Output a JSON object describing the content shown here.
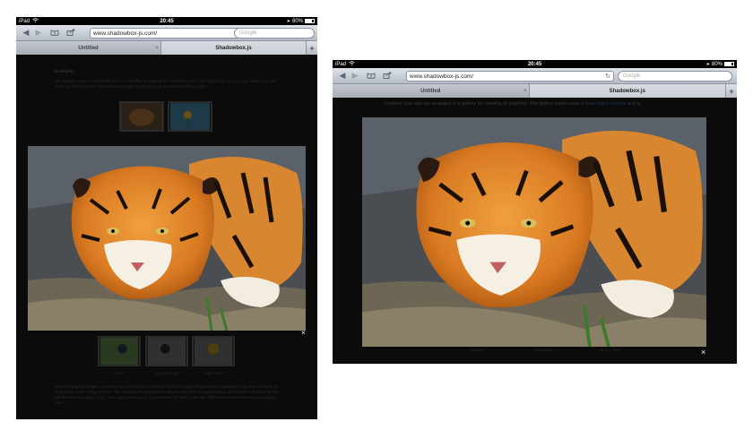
{
  "status": {
    "device": "iPad",
    "time": "20:45",
    "battery": "80%"
  },
  "browser": {
    "url": "www.shadowbox-js.com/",
    "search_placeholder": "Google",
    "tabs": [
      {
        "label": "Untitled",
        "close": "×"
      },
      {
        "label": "Shadowbox.js"
      }
    ],
    "new_tab": "+"
  },
  "icons": {
    "back": "◀",
    "forward": "▶",
    "bookmarks": "bookmarks-icon",
    "share": "share-icon",
    "reload": "↻",
    "close": "×",
    "wifi": "wifi-icon",
    "location": "➤"
  },
  "portrait": {
    "heading": "Examples",
    "intro": "The simplest way to use Shadowbox is to display a single piece of content, with a thumbnail link on the page. When the user clicks on the thumbnail, Shadowbox will open to display a larger version of the image.",
    "thumb_captions": [
      "Brian",
      "Olympic Rings",
      "Flash Video"
    ],
    "outro": "When displaying images, you have some flexibility in deciding how the image will appear in Shadowbox that are not bound to display the entire image at once. The following three examples display the same image but each uses a different value for the handleOversize option. Note: You may have to scroll your browser window to see the difference between the various options here.",
    "lightbox_close": "×"
  },
  "landscape": {
    "gallery_text": "Content may also be arranged in a gallery for viewing all together. The gallery below uses a",
    "gallery_link": "flash video overlay",
    "gallery_text_end": "and is",
    "thumb_captions": [
      "Felis Leo",
      "Chimp Chat",
      "Tarsius Video"
    ],
    "lightbox_close": "×"
  },
  "colors": {
    "toolbar_top": "#dfe3e8",
    "toolbar_bottom": "#b5bcc6",
    "overlay": "#0b0b0b",
    "tiger_orange": "#e0892f"
  }
}
